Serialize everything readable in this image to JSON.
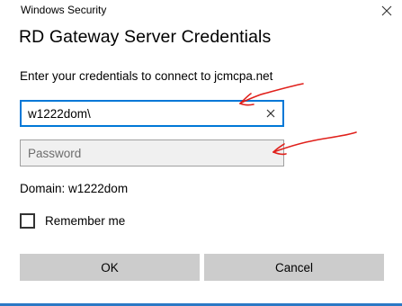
{
  "window": {
    "app_title": "Windows Security",
    "heading": "RD Gateway Server Credentials",
    "close_icon": "close-icon"
  },
  "form": {
    "prompt": "Enter your credentials to connect to jcmcpa.net",
    "username": {
      "value": "w1222dom\\",
      "clear_icon": "clear-x-icon"
    },
    "password": {
      "placeholder": "Password",
      "value": ""
    },
    "domain_label": "Domain: w1222dom",
    "remember_me": {
      "label": "Remember me",
      "checked": false
    }
  },
  "buttons": {
    "ok_label": "OK",
    "cancel_label": "Cancel"
  },
  "colors": {
    "accent": "#0078d7",
    "button_bg": "#cccccc",
    "annotation": "#e0201b"
  }
}
